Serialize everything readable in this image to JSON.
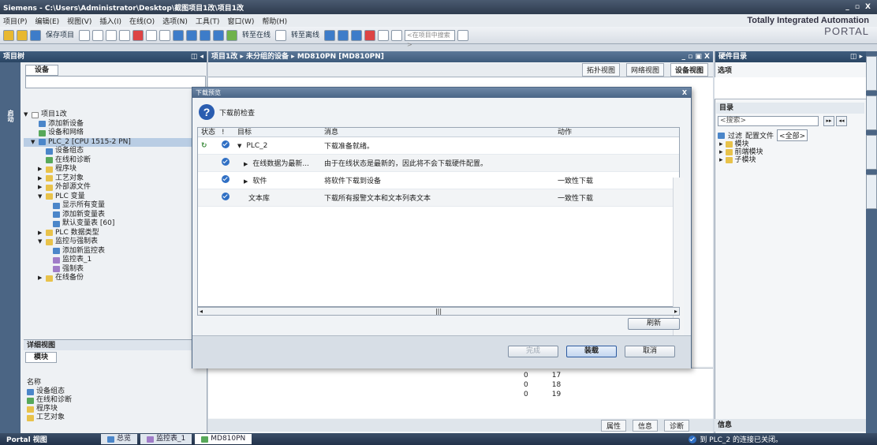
{
  "window": {
    "title": "Siemens - C:\\Users\\Administrator\\Desktop\\截图项目1改\\项目1改",
    "controls": "_ ▫ X"
  },
  "menu": [
    "项目(P)",
    "编辑(E)",
    "视图(V)",
    "插入(I)",
    "在线(O)",
    "选项(N)",
    "工具(T)",
    "窗口(W)",
    "帮助(H)"
  ],
  "toolbar": {
    "save_label": "保存项目",
    "go_online": "转至在线",
    "go_offline": "转至离线",
    "search_placeholder": "<在项目中搜索>"
  },
  "brand": {
    "line1": "Totally Integrated Automation",
    "line2": "PORTAL"
  },
  "left_pane": {
    "title": "项目树",
    "strip_label": "启动",
    "devices_tab": "设备",
    "tree": [
      {
        "label": "项目1改",
        "indent": 0,
        "icon": "w",
        "arrow": "▼"
      },
      {
        "label": "添加新设备",
        "indent": 1,
        "icon": "b",
        "arrow": ""
      },
      {
        "label": "设备和网络",
        "indent": 1,
        "icon": "g",
        "arrow": ""
      },
      {
        "label": "PLC_2 [CPU 1515-2 PN]",
        "indent": 1,
        "icon": "b",
        "arrow": "▼",
        "selected": true
      },
      {
        "label": "设备组态",
        "indent": 2,
        "icon": "b",
        "arrow": ""
      },
      {
        "label": "在线和诊断",
        "indent": 2,
        "icon": "g",
        "arrow": ""
      },
      {
        "label": "程序块",
        "indent": 2,
        "icon": "y",
        "arrow": "▶"
      },
      {
        "label": "工艺对象",
        "indent": 2,
        "icon": "y",
        "arrow": "▶"
      },
      {
        "label": "外部源文件",
        "indent": 2,
        "icon": "y",
        "arrow": "▶"
      },
      {
        "label": "PLC 变量",
        "indent": 2,
        "icon": "y",
        "arrow": "▼"
      },
      {
        "label": "显示所有变量",
        "indent": 3,
        "icon": "b",
        "arrow": ""
      },
      {
        "label": "添加新变量表",
        "indent": 3,
        "icon": "b",
        "arrow": ""
      },
      {
        "label": "默认变量表 [60]",
        "indent": 3,
        "icon": "b",
        "arrow": ""
      },
      {
        "label": "PLC 数据类型",
        "indent": 2,
        "icon": "y",
        "arrow": "▶"
      },
      {
        "label": "监控与强制表",
        "indent": 2,
        "icon": "y",
        "arrow": "▼"
      },
      {
        "label": "添加新监控表",
        "indent": 3,
        "icon": "b",
        "arrow": ""
      },
      {
        "label": "监控表_1",
        "indent": 3,
        "icon": "p",
        "arrow": ""
      },
      {
        "label": "强制表",
        "indent": 3,
        "icon": "p",
        "arrow": ""
      },
      {
        "label": "在线备份",
        "indent": 2,
        "icon": "y",
        "arrow": "▶"
      }
    ],
    "detail_view": "详细视图",
    "module_tab": "模块",
    "name_header": "名称",
    "detail_items": [
      "设备组态",
      "在线和诊断",
      "程序块",
      "工艺对象"
    ]
  },
  "center": {
    "breadcrumb": "项目1改 ▸ 未分组的设备 ▸ MD810PN [MD810PN]",
    "views": [
      "拓扑视图",
      "网络视图",
      "设备视图"
    ],
    "lower_rows": [
      [
        "0",
        "17"
      ],
      [
        "0",
        "18"
      ],
      [
        "0",
        "19"
      ]
    ],
    "bottom_tabs": [
      "属性",
      "信息",
      "诊断"
    ]
  },
  "dialog": {
    "title": "下载预览",
    "heading": "下载前检查",
    "columns": {
      "status": "状态",
      "dot": "!",
      "target": "目标",
      "message": "消息",
      "action": "动作"
    },
    "rows": [
      {
        "status": "↻",
        "target": "PLC_2",
        "arrow": "▼",
        "indent": 0,
        "message": "下载准备就绪。",
        "action": ""
      },
      {
        "status": "",
        "target": "在线数据为最新...",
        "arrow": "▶",
        "indent": 1,
        "message": "由于在线状态是最新的，因此将不会下载硬件配置。",
        "action": ""
      },
      {
        "status": "",
        "target": "软件",
        "arrow": "▶",
        "indent": 1,
        "message": "将软件下载到设备",
        "action": "一致性下载"
      },
      {
        "status": "",
        "target": "文本库",
        "arrow": "",
        "indent": 1,
        "message": "下载所有报警文本和文本列表文本",
        "action": "一致性下载"
      }
    ],
    "refresh": "刷新",
    "finish": "完成",
    "load": "装载",
    "cancel": "取消"
  },
  "right_pane": {
    "title": "硬件目录",
    "options": "选项",
    "catalog": "目录",
    "search": "<搜索>",
    "filter": "过滤",
    "profile_label": "配置文件",
    "profile_value": "<全部>",
    "tree": [
      "模块",
      "前端模块",
      "子模块"
    ],
    "info": "信息"
  },
  "taskbar": {
    "portal": "Portal 视图",
    "tasks": [
      "总览",
      "监控表_1",
      "MD810PN"
    ],
    "status": "到 PLC_2 的连接已关闭。"
  },
  "colors": {
    "accent": "#2f6fc4",
    "pane_header": "#2a4563",
    "status_ok": "#3a8a3a"
  }
}
